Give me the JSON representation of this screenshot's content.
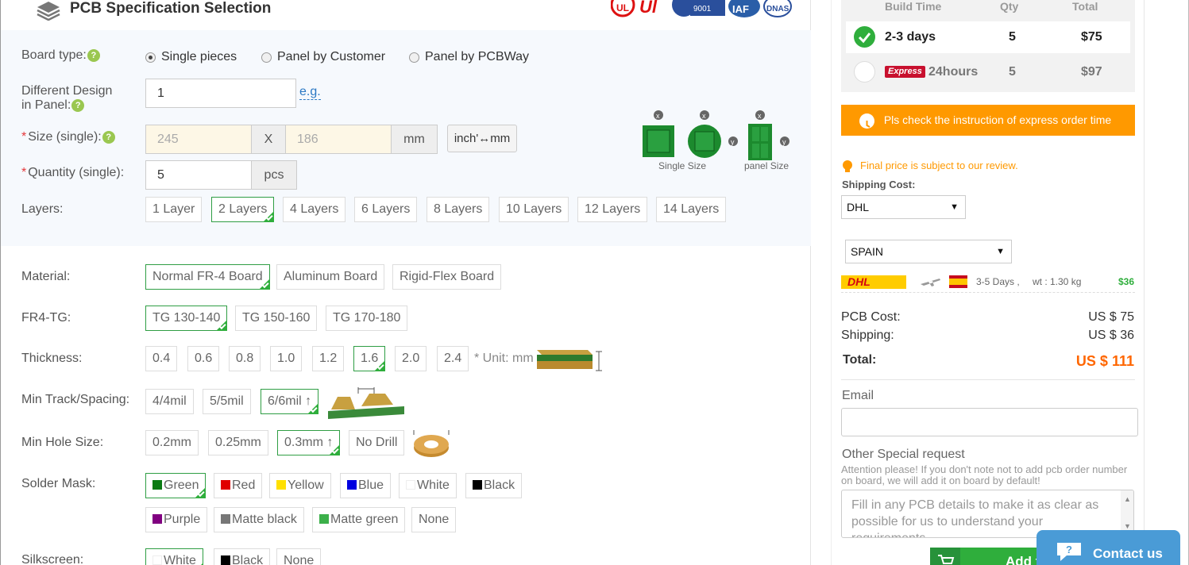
{
  "header": {
    "title": "PCB Specification Selection",
    "cert_logos": [
      "UL",
      "UL",
      "ISO 9001",
      "IAF",
      "DNV"
    ]
  },
  "board_type": {
    "label": "Board type:",
    "options": [
      {
        "label": "Single pieces",
        "selected": true
      },
      {
        "label": "Panel by Customer",
        "selected": false
      },
      {
        "label": "Panel by PCBWay",
        "selected": false
      }
    ]
  },
  "design_in_panel": {
    "label_line1": "Different Design",
    "label_line2": "in Panel:",
    "value": "1",
    "eg_link": "e.g."
  },
  "size": {
    "label": "Size (single):",
    "width_placeholder": "245",
    "x_label": "X",
    "height_placeholder": "186",
    "unit": "mm",
    "convert_button": "inch'↔mm",
    "illus_single": "Single Size",
    "illus_panel": "panel Size"
  },
  "quantity": {
    "label": "Quantity (single):",
    "value": "5",
    "unit": "pcs"
  },
  "layers": {
    "label": "Layers:",
    "options": [
      "1 Layer",
      "2 Layers",
      "4 Layers",
      "6 Layers",
      "8 Layers",
      "10 Layers",
      "12 Layers",
      "14 Layers"
    ],
    "selected": "2 Layers"
  },
  "material": {
    "label": "Material:",
    "options": [
      "Normal FR-4 Board",
      "Aluminum Board",
      "Rigid-Flex Board"
    ],
    "selected": "Normal FR-4 Board"
  },
  "fr4_tg": {
    "label": "FR4-TG:",
    "options": [
      "TG 130-140",
      "TG 150-160",
      "TG 170-180"
    ],
    "selected": "TG 130-140"
  },
  "thickness": {
    "label": "Thickness:",
    "options": [
      "0.4",
      "0.6",
      "0.8",
      "1.0",
      "1.2",
      "1.6",
      "2.0",
      "2.4"
    ],
    "selected": "1.6",
    "unit_note": "* Unit: mm"
  },
  "track": {
    "label": "Min Track/Spacing:",
    "options": [
      "4/4mil",
      "5/5mil",
      "6/6mil ↑"
    ],
    "selected": "6/6mil ↑"
  },
  "hole": {
    "label": "Min Hole Size:",
    "options": [
      "0.2mm",
      "0.25mm",
      "0.3mm ↑",
      "No Drill"
    ],
    "selected": "0.3mm ↑"
  },
  "solder_mask": {
    "label": "Solder Mask:",
    "options": [
      {
        "label": "Green",
        "color": "#0a7a12"
      },
      {
        "label": "Red",
        "color": "#e00000"
      },
      {
        "label": "Yellow",
        "color": "#ffe000"
      },
      {
        "label": "Blue",
        "color": "#0000e0"
      },
      {
        "label": "White",
        "color": "#ffffff"
      },
      {
        "label": "Black",
        "color": "#000000"
      },
      {
        "label": "Purple",
        "color": "#800080"
      },
      {
        "label": "Matte black",
        "color": "#777777"
      },
      {
        "label": "Matte green",
        "color": "#3cb04a"
      },
      {
        "label": "None",
        "color": ""
      }
    ],
    "selected": "Green"
  },
  "silkscreen": {
    "label": "Silkscreen:",
    "options": [
      {
        "label": "White",
        "color": "#ffffff"
      },
      {
        "label": "Black",
        "color": "#000000"
      },
      {
        "label": "None",
        "color": ""
      }
    ],
    "selected": "White"
  },
  "build_time": {
    "headers": [
      "Build Time",
      "Qty",
      "Total"
    ],
    "rows": [
      {
        "time": "2-3 days",
        "qty": "5",
        "total": "$75",
        "selected": true
      },
      {
        "badge": "Express",
        "time": "24hours",
        "qty": "5",
        "total": "$97",
        "selected": false
      }
    ]
  },
  "express_notice": "Pls check the instruction of express order time",
  "price_note": "Final price is subject to our review.",
  "shipping": {
    "label": "Shipping Cost:",
    "carrier": "DHL",
    "country": "SPAIN",
    "carrier_logo": "DHL",
    "days": "3-5 Days ,",
    "weight": "wt : 1.30 kg",
    "cost": "$36"
  },
  "costs": {
    "pcb_label": "PCB Cost:",
    "pcb_value": "US $ 75",
    "ship_label": "Shipping:",
    "ship_value": "US $ 36",
    "total_label": "Total:",
    "total_value": "US $ 111"
  },
  "email": {
    "label": "Email",
    "value": ""
  },
  "special": {
    "label": "Other Special request",
    "note": "Attention please! If you don't note not to add pcb order number on board, we will add it on board by default!",
    "placeholder": "Fill in any PCB details to make it as clear as possible for us to understand your requirements."
  },
  "add_button": "Add t",
  "contact": "Contact us",
  "colors": {
    "accent_green": "#2fae3c",
    "orange": "#ff9900",
    "price_orange": "#ff6600",
    "contact_blue": "#4a9bd6"
  }
}
